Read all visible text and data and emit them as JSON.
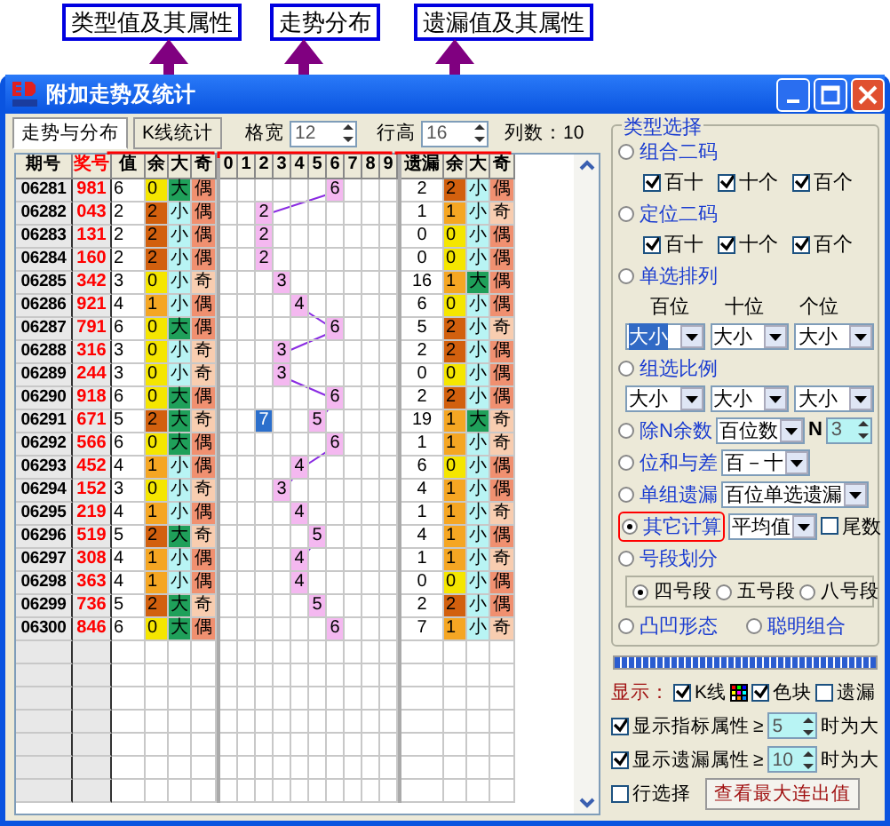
{
  "annotations": [
    {
      "label": "类型值及其属性"
    },
    {
      "label": "走势分布"
    },
    {
      "label": "遗漏值及其属性"
    }
  ],
  "window": {
    "title": "附加走势及统计"
  },
  "toolbar": {
    "tabs": [
      {
        "label": "走势与分布",
        "selected": true
      },
      {
        "label": "K线统计",
        "selected": false
      }
    ],
    "cell_width": {
      "label": "格宽",
      "value": "12"
    },
    "row_height": {
      "label": "行高",
      "value": "16"
    },
    "column_count": "列数：10"
  },
  "table": {
    "columns": {
      "issue": "期号",
      "number": "奖号",
      "value": "值",
      "rem": "余",
      "size": "大",
      "parity": "奇",
      "digits": [
        "0",
        "1",
        "2",
        "3",
        "4",
        "5",
        "6",
        "7",
        "8",
        "9"
      ],
      "miss": "遗漏",
      "m_rem": "余",
      "m_size": "大",
      "m_parity": "奇"
    },
    "rows": [
      {
        "issue": "06281",
        "number": "981",
        "value": "6",
        "rem": {
          "text": "0",
          "color": "#f5e600"
        },
        "size": "大",
        "big": true,
        "parity": "偶",
        "odd": false,
        "trend": "6",
        "miss": "2",
        "m_rem": {
          "text": "2",
          "color": "#d2600e"
        },
        "m_size": "小",
        "m_big": false,
        "m_parity": "偶",
        "m_odd": false
      },
      {
        "issue": "06282",
        "number": "043",
        "value": "2",
        "rem": {
          "text": "2",
          "color": "#d2600e"
        },
        "size": "小",
        "big": false,
        "parity": "偶",
        "odd": false,
        "trend": "2",
        "miss": "1",
        "m_rem": {
          "text": "1",
          "color": "#f5a623"
        },
        "m_size": "小",
        "m_big": false,
        "m_parity": "奇",
        "m_odd": true
      },
      {
        "issue": "06283",
        "number": "131",
        "value": "2",
        "rem": {
          "text": "2",
          "color": "#d2600e"
        },
        "size": "小",
        "big": false,
        "parity": "偶",
        "odd": false,
        "trend": "2",
        "miss": "0",
        "m_rem": {
          "text": "0",
          "color": "#f5e600"
        },
        "m_size": "小",
        "m_big": false,
        "m_parity": "偶",
        "m_odd": false
      },
      {
        "issue": "06284",
        "number": "160",
        "value": "2",
        "rem": {
          "text": "2",
          "color": "#d2600e"
        },
        "size": "小",
        "big": false,
        "parity": "偶",
        "odd": false,
        "trend": "2",
        "miss": "0",
        "m_rem": {
          "text": "0",
          "color": "#f5e600"
        },
        "m_size": "小",
        "m_big": false,
        "m_parity": "偶",
        "m_odd": false
      },
      {
        "issue": "06285",
        "number": "342",
        "value": "3",
        "rem": {
          "text": "0",
          "color": "#f5e600"
        },
        "size": "小",
        "big": false,
        "parity": "奇",
        "odd": true,
        "trend": "3",
        "miss": "16",
        "m_rem": {
          "text": "1",
          "color": "#f5a623"
        },
        "m_size": "大",
        "m_big": true,
        "m_parity": "偶",
        "m_odd": false
      },
      {
        "issue": "06286",
        "number": "921",
        "value": "4",
        "rem": {
          "text": "1",
          "color": "#f5a623"
        },
        "size": "小",
        "big": false,
        "parity": "偶",
        "odd": false,
        "trend": "4",
        "miss": "6",
        "m_rem": {
          "text": "0",
          "color": "#f5e600"
        },
        "m_size": "小",
        "m_big": false,
        "m_parity": "偶",
        "m_odd": false
      },
      {
        "issue": "06287",
        "number": "791",
        "value": "6",
        "rem": {
          "text": "0",
          "color": "#f5e600"
        },
        "size": "大",
        "big": true,
        "parity": "偶",
        "odd": false,
        "trend": "6",
        "miss": "5",
        "m_rem": {
          "text": "2",
          "color": "#d2600e"
        },
        "m_size": "小",
        "m_big": false,
        "m_parity": "奇",
        "m_odd": true
      },
      {
        "issue": "06288",
        "number": "316",
        "value": "3",
        "rem": {
          "text": "0",
          "color": "#f5e600"
        },
        "size": "小",
        "big": false,
        "parity": "奇",
        "odd": true,
        "trend": "3",
        "miss": "2",
        "m_rem": {
          "text": "2",
          "color": "#d2600e"
        },
        "m_size": "小",
        "m_big": false,
        "m_parity": "偶",
        "m_odd": false
      },
      {
        "issue": "06289",
        "number": "244",
        "value": "3",
        "rem": {
          "text": "0",
          "color": "#f5e600"
        },
        "size": "小",
        "big": false,
        "parity": "奇",
        "odd": true,
        "trend": "3",
        "miss": "0",
        "m_rem": {
          "text": "0",
          "color": "#f5e600"
        },
        "m_size": "小",
        "m_big": false,
        "m_parity": "偶",
        "m_odd": false
      },
      {
        "issue": "06290",
        "number": "918",
        "value": "6",
        "rem": {
          "text": "0",
          "color": "#f5e600"
        },
        "size": "大",
        "big": true,
        "parity": "偶",
        "odd": false,
        "trend": "6",
        "miss": "2",
        "m_rem": {
          "text": "2",
          "color": "#d2600e"
        },
        "m_size": "小",
        "m_big": false,
        "m_parity": "偶",
        "m_odd": false
      },
      {
        "issue": "06291",
        "number": "671",
        "value": "5",
        "rem": {
          "text": "2",
          "color": "#d2600e"
        },
        "size": "大",
        "big": true,
        "parity": "奇",
        "odd": true,
        "mark": "7",
        "trend": "5",
        "miss": "19",
        "m_rem": {
          "text": "1",
          "color": "#f5a623"
        },
        "m_size": "大",
        "m_big": true,
        "m_parity": "奇",
        "m_odd": true
      },
      {
        "issue": "06292",
        "number": "566",
        "value": "6",
        "rem": {
          "text": "0",
          "color": "#f5e600"
        },
        "size": "大",
        "big": true,
        "parity": "偶",
        "odd": false,
        "trend": "6",
        "miss": "1",
        "m_rem": {
          "text": "1",
          "color": "#f5a623"
        },
        "m_size": "小",
        "m_big": false,
        "m_parity": "奇",
        "m_odd": true
      },
      {
        "issue": "06293",
        "number": "452",
        "value": "4",
        "rem": {
          "text": "1",
          "color": "#f5a623"
        },
        "size": "小",
        "big": false,
        "parity": "偶",
        "odd": false,
        "trend": "4",
        "miss": "6",
        "m_rem": {
          "text": "0",
          "color": "#f5e600"
        },
        "m_size": "小",
        "m_big": false,
        "m_parity": "偶",
        "m_odd": false
      },
      {
        "issue": "06294",
        "number": "152",
        "value": "3",
        "rem": {
          "text": "0",
          "color": "#f5e600"
        },
        "size": "小",
        "big": false,
        "parity": "奇",
        "odd": true,
        "trend": "3",
        "miss": "4",
        "m_rem": {
          "text": "1",
          "color": "#f5a623"
        },
        "m_size": "小",
        "m_big": false,
        "m_parity": "偶",
        "m_odd": false
      },
      {
        "issue": "06295",
        "number": "219",
        "value": "4",
        "rem": {
          "text": "1",
          "color": "#f5a623"
        },
        "size": "小",
        "big": false,
        "parity": "偶",
        "odd": false,
        "trend": "4",
        "miss": "1",
        "m_rem": {
          "text": "1",
          "color": "#f5a623"
        },
        "m_size": "小",
        "m_big": false,
        "m_parity": "奇",
        "m_odd": true
      },
      {
        "issue": "06296",
        "number": "519",
        "value": "5",
        "rem": {
          "text": "2",
          "color": "#d2600e"
        },
        "size": "大",
        "big": true,
        "parity": "奇",
        "odd": true,
        "trend": "5",
        "miss": "4",
        "m_rem": {
          "text": "1",
          "color": "#f5a623"
        },
        "m_size": "小",
        "m_big": false,
        "m_parity": "偶",
        "m_odd": false
      },
      {
        "issue": "06297",
        "number": "308",
        "value": "4",
        "rem": {
          "text": "1",
          "color": "#f5a623"
        },
        "size": "小",
        "big": false,
        "parity": "偶",
        "odd": false,
        "trend": "4",
        "miss": "1",
        "m_rem": {
          "text": "1",
          "color": "#f5a623"
        },
        "m_size": "小",
        "m_big": false,
        "m_parity": "奇",
        "m_odd": true
      },
      {
        "issue": "06298",
        "number": "363",
        "value": "4",
        "rem": {
          "text": "1",
          "color": "#f5a623"
        },
        "size": "小",
        "big": false,
        "parity": "偶",
        "odd": false,
        "trend": "4",
        "miss": "0",
        "m_rem": {
          "text": "0",
          "color": "#f5e600"
        },
        "m_size": "小",
        "m_big": false,
        "m_parity": "偶",
        "m_odd": false
      },
      {
        "issue": "06299",
        "number": "736",
        "value": "5",
        "rem": {
          "text": "2",
          "color": "#d2600e"
        },
        "size": "大",
        "big": true,
        "parity": "奇",
        "odd": true,
        "trend": "5",
        "miss": "2",
        "m_rem": {
          "text": "2",
          "color": "#d2600e"
        },
        "m_size": "小",
        "m_big": false,
        "m_parity": "偶",
        "m_odd": false
      },
      {
        "issue": "06300",
        "number": "846",
        "value": "6",
        "rem": {
          "text": "0",
          "color": "#f5e600"
        },
        "size": "大",
        "big": true,
        "parity": "偶",
        "odd": false,
        "trend": "6",
        "miss": "7",
        "m_rem": {
          "text": "1",
          "color": "#f5a623"
        },
        "m_size": "小",
        "m_big": false,
        "m_parity": "奇",
        "m_odd": true
      }
    ]
  },
  "panel": {
    "title": "类型选择",
    "options": [
      {
        "kind": "checks",
        "label": "组合二码",
        "selected": false,
        "checks": [
          {
            "label": "百十",
            "checked": true
          },
          {
            "label": "十个",
            "checked": true
          },
          {
            "label": "百个",
            "checked": true
          }
        ]
      },
      {
        "kind": "checks",
        "label": "定位二码",
        "selected": false,
        "checks": [
          {
            "label": "百十",
            "checked": true
          },
          {
            "label": "十个",
            "checked": true
          },
          {
            "label": "百个",
            "checked": true
          }
        ]
      },
      {
        "kind": "dropdowns",
        "label": "单选排列",
        "selected": false,
        "headers": [
          "百位",
          "十位",
          "个位"
        ],
        "dropdowns": [
          {
            "value": "大小",
            "highlighted": true
          },
          {
            "value": "大小",
            "highlighted": false
          },
          {
            "value": "大小",
            "highlighted": false
          }
        ]
      },
      {
        "kind": "dropdowns",
        "label": "组选比例",
        "selected": false,
        "dropdowns": [
          {
            "value": "大小",
            "highlighted": false
          },
          {
            "value": "大小",
            "highlighted": false
          },
          {
            "value": "大小",
            "highlighted": false
          }
        ]
      },
      {
        "kind": "modulo",
        "label": "除N余数",
        "selected": false,
        "dropdown": "百位数",
        "n_label": "N",
        "n_value": "3"
      },
      {
        "kind": "select",
        "label": "位和与差",
        "selected": false,
        "dropdown": "百－十"
      },
      {
        "kind": "select",
        "label": "单组遗漏",
        "selected": false,
        "dropdown": "百位单选遗漏"
      },
      {
        "kind": "select",
        "label": "其它计算",
        "selected": true,
        "outlined": true,
        "dropdown": "平均值",
        "check": {
          "label": "尾数",
          "checked": false
        }
      },
      {
        "kind": "segments",
        "label": "号段划分",
        "selected": false,
        "segments": [
          {
            "label": "四号段",
            "selected": true
          },
          {
            "label": "五号段",
            "selected": false
          },
          {
            "label": "八号段",
            "selected": false
          }
        ]
      },
      {
        "kind": "pair",
        "items": [
          {
            "label": "凸凹形态",
            "selected": false
          },
          {
            "label": "聪明组合",
            "selected": false
          }
        ]
      }
    ]
  },
  "progress": {
    "level": 1
  },
  "display": {
    "label": "显示：",
    "kline": {
      "label": "K线",
      "checked": true
    },
    "color_block": {
      "label": "色块",
      "checked": true
    },
    "miss": {
      "label": "遗漏",
      "checked": false
    }
  },
  "thresholds": [
    {
      "label": "显示指标属性",
      "checked": true,
      "sign": "≥",
      "value": "5",
      "suffix": "时为大"
    },
    {
      "label": "显示遗漏属性",
      "checked": true,
      "sign": "≥",
      "value": "10",
      "suffix": "时为大"
    }
  ],
  "row_select": {
    "label": "行选择",
    "checked": false
  },
  "max_button": "查看最大连出值"
}
